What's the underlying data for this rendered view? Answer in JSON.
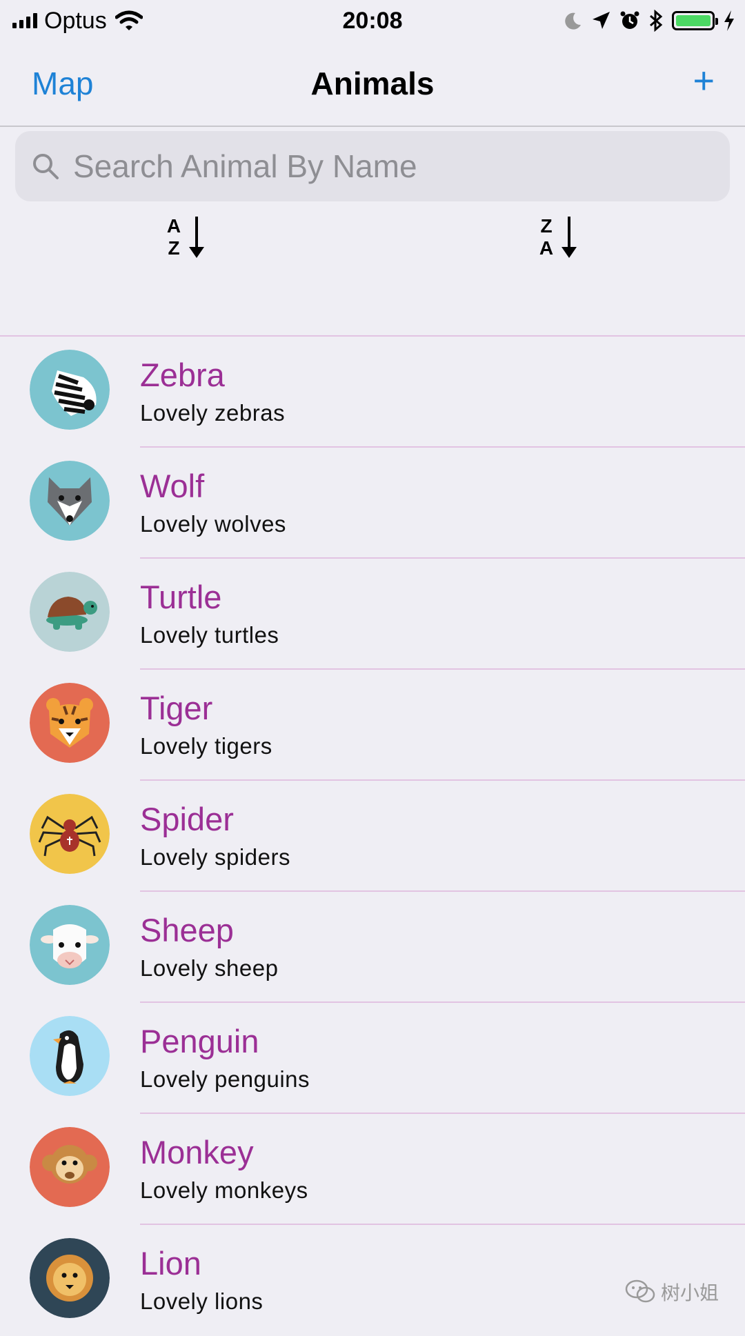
{
  "status_bar": {
    "carrier": "Optus",
    "time": "20:08",
    "battery_color": "#4cd964"
  },
  "nav": {
    "left": "Map",
    "title": "Animals",
    "right": "+"
  },
  "search": {
    "placeholder": "Search Animal By Name"
  },
  "sort": {
    "az": {
      "top": "A",
      "bottom": "Z"
    },
    "za": {
      "top": "Z",
      "bottom": "A"
    }
  },
  "animals": [
    {
      "name": "Zebra",
      "desc": "Lovely zebras",
      "icon": "zebra-icon",
      "bg": "#7cc4cf"
    },
    {
      "name": "Wolf",
      "desc": "Lovely wolves",
      "icon": "wolf-icon",
      "bg": "#7cc4cf"
    },
    {
      "name": "Turtle",
      "desc": "Lovely turtles",
      "icon": "turtle-icon",
      "bg": "#b9d3d6"
    },
    {
      "name": "Tiger",
      "desc": "Lovely tigers",
      "icon": "tiger-icon",
      "bg": "#e36a52"
    },
    {
      "name": "Spider",
      "desc": "Lovely spiders",
      "icon": "spider-icon",
      "bg": "#f1c54a"
    },
    {
      "name": "Sheep",
      "desc": "Lovely sheep",
      "icon": "sheep-icon",
      "bg": "#7cc4cf"
    },
    {
      "name": "Penguin",
      "desc": "Lovely penguins",
      "icon": "penguin-icon",
      "bg": "#a9def4"
    },
    {
      "name": "Monkey",
      "desc": "Lovely monkeys",
      "icon": "monkey-icon",
      "bg": "#e36a52"
    },
    {
      "name": "Lion",
      "desc": "Lovely lions",
      "icon": "lion-icon",
      "bg": "#2f4656"
    }
  ],
  "watermark": "树小姐",
  "colors": {
    "accent": "#1e82d6",
    "title_purple": "#9b2f95",
    "separator": "#e2c3e2"
  }
}
